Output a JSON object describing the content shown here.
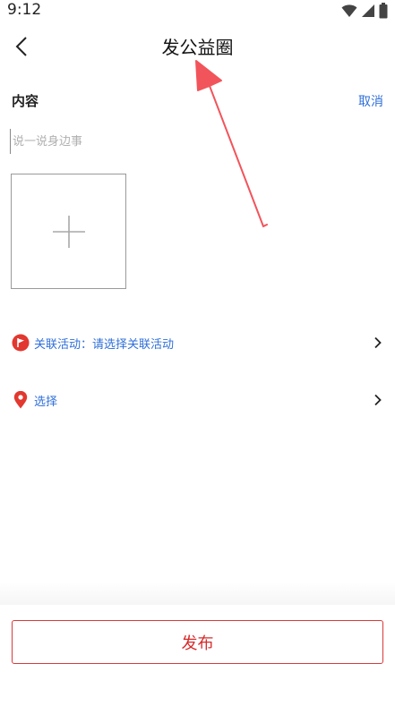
{
  "status_bar": {
    "time": "9:12"
  },
  "nav": {
    "title": "发公益圈"
  },
  "form": {
    "section_label": "内容",
    "cancel_label": "取消",
    "content_placeholder": "说一说身边事"
  },
  "options": {
    "related_activity_label": "关联活动：请选择关联活动",
    "location_label": "选择"
  },
  "footer": {
    "publish_label": "发布"
  },
  "colors": {
    "accent_blue": "#2f6fd9",
    "brand_red": "#d83a3a",
    "annotation_arrow": "#f2545b"
  },
  "icons": {
    "back": "chevron-left-icon",
    "wifi": "wifi-icon",
    "signal": "signal-icon",
    "battery": "battery-icon",
    "add": "plus-icon",
    "activity": "flag-icon",
    "location": "map-pin-icon",
    "chevron": "chevron-right-icon"
  }
}
